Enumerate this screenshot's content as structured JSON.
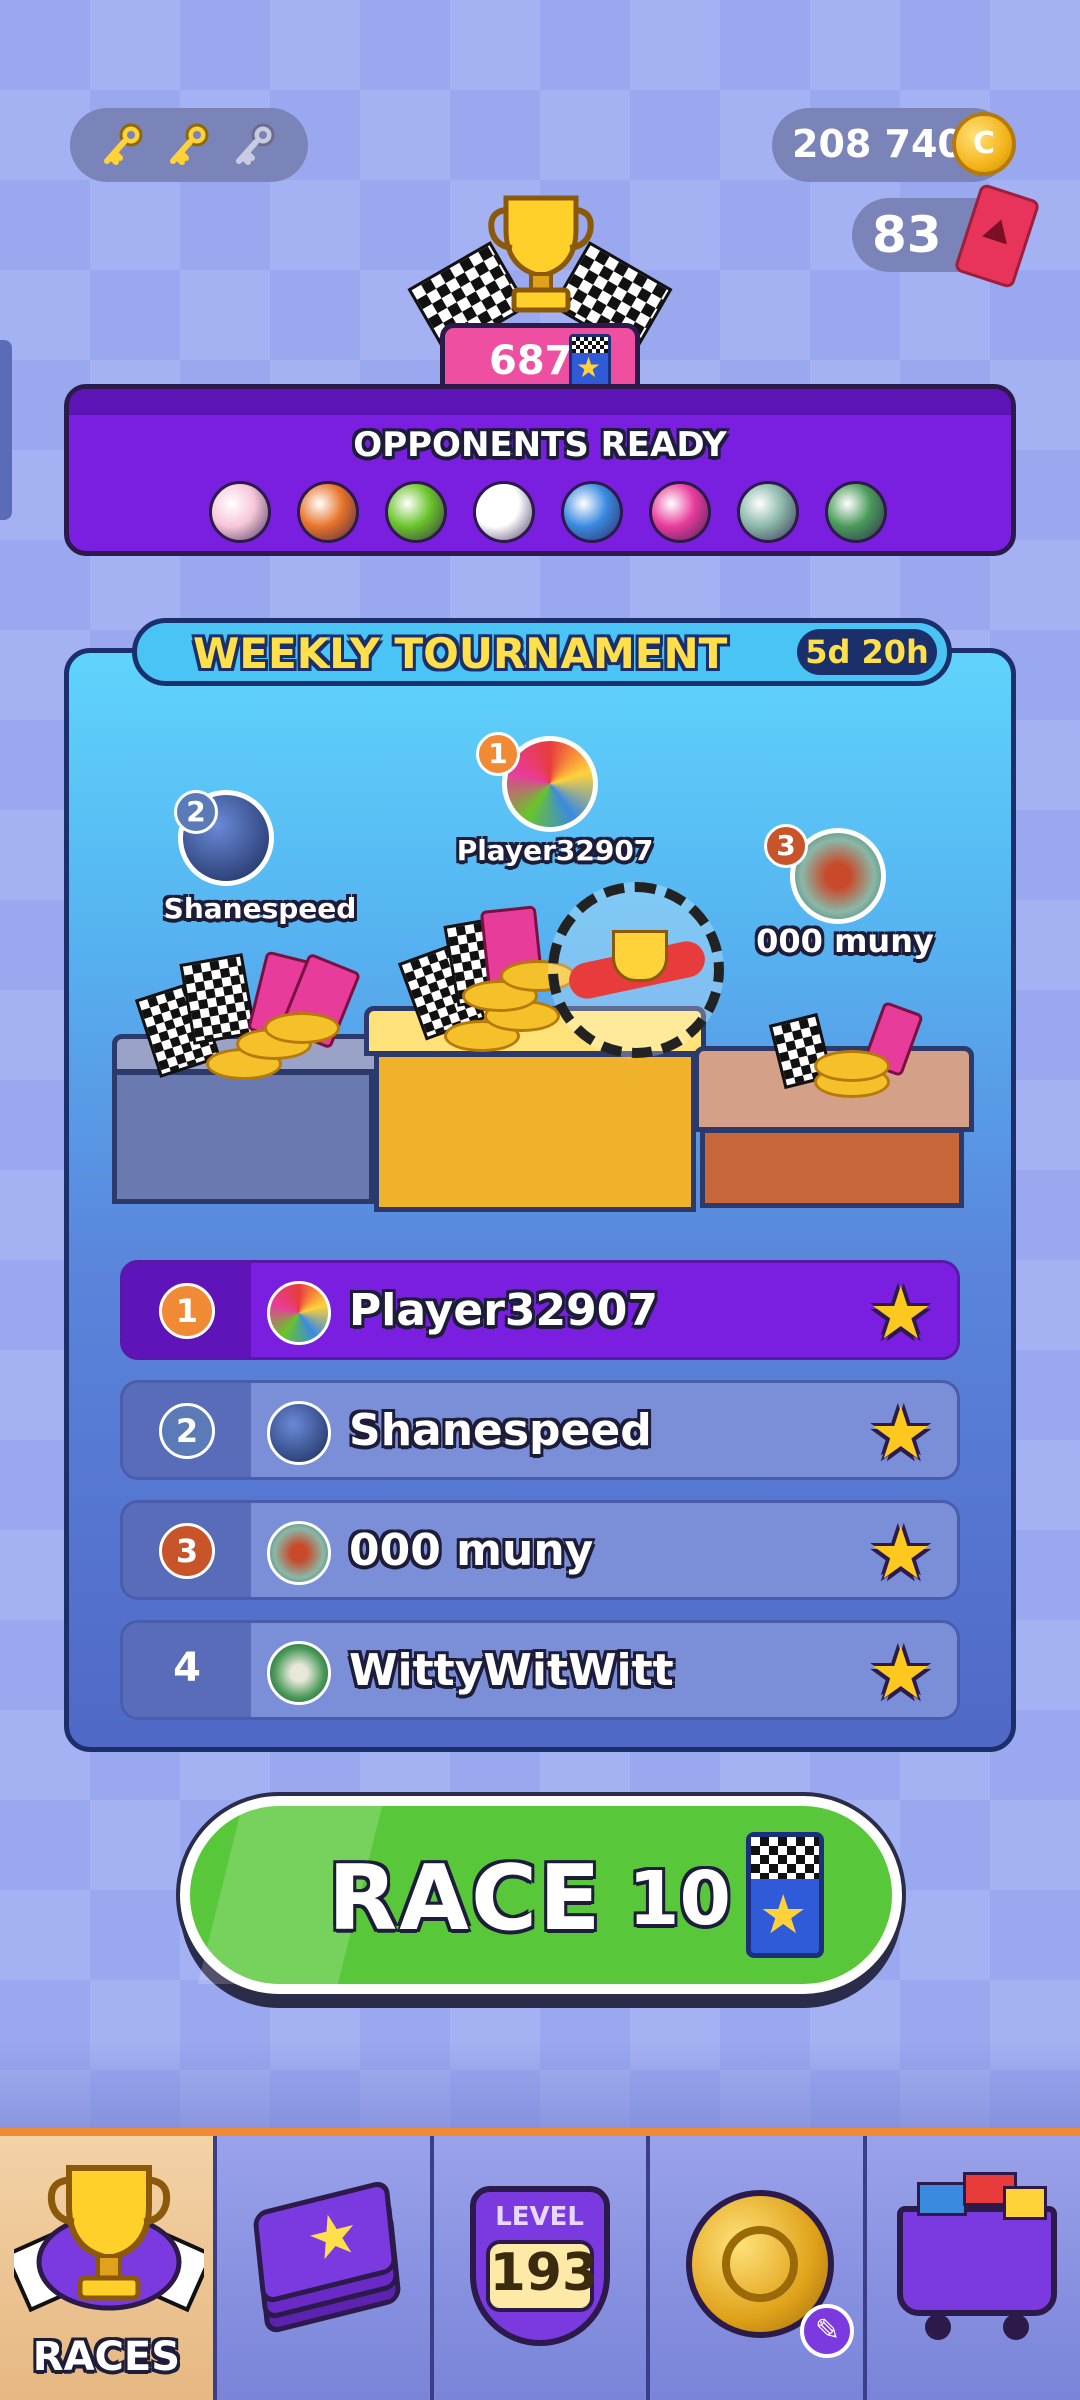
{
  "currency": {
    "keys": {
      "filled": 2,
      "total": 3
    },
    "coins": "208 740",
    "coin_glyph": "C",
    "tickets": "83"
  },
  "trophy": {
    "score": "687"
  },
  "opponents": {
    "title": "OPPONENTS READY",
    "balls": [
      {
        "icon": "cupcake-ball-icon",
        "color": "#f6c6d8"
      },
      {
        "icon": "fox-ball-icon",
        "color": "#e8742a"
      },
      {
        "icon": "apple-ball-icon",
        "color": "#6ac42a"
      },
      {
        "icon": "soccer-ball-icon",
        "color": "#ffffff"
      },
      {
        "icon": "blue-helmet-ball-icon",
        "color": "#3a8ae0"
      },
      {
        "icon": "pink-yarn-ball-icon",
        "color": "#e83c9a"
      },
      {
        "icon": "wheel-ball-icon",
        "color": "#8ab8a8"
      },
      {
        "icon": "green-wheel-ball-icon",
        "color": "#4a9a5a"
      }
    ]
  },
  "tournament": {
    "title": "WEEKLY TOURNAMENT",
    "timer": "5d 20h",
    "podium": [
      {
        "rank": "1",
        "name": "Player32907"
      },
      {
        "rank": "2",
        "name": "Shanespeed"
      },
      {
        "rank": "3",
        "name": "000 muny"
      }
    ],
    "leaderboard": [
      {
        "rank": "1",
        "name": "Player32907",
        "highlight": true
      },
      {
        "rank": "2",
        "name": "Shanespeed",
        "highlight": false
      },
      {
        "rank": "3",
        "name": "000 muny",
        "highlight": false
      },
      {
        "rank": "4",
        "name": "WittyWitWitt",
        "highlight": false
      }
    ],
    "star_glyph": "★"
  },
  "race_button": {
    "label": "RACE",
    "cost": "10"
  },
  "nav": {
    "items": [
      {
        "label": "RACES",
        "icon": "trophy-icon",
        "active": true
      },
      {
        "label": "",
        "icon": "cards-icon",
        "active": false
      },
      {
        "label": "LEVEL",
        "value": "193",
        "icon": "level-badge-icon",
        "active": false
      },
      {
        "label": "",
        "icon": "ball-upgrade-icon",
        "active": false
      },
      {
        "label": "",
        "icon": "shop-cart-icon",
        "active": false
      }
    ]
  },
  "colors": {
    "accent_purple": "#7a1fe0",
    "race_green": "#58c83a",
    "gold": "#f4b41a",
    "nav_orange": "#f08a34"
  }
}
